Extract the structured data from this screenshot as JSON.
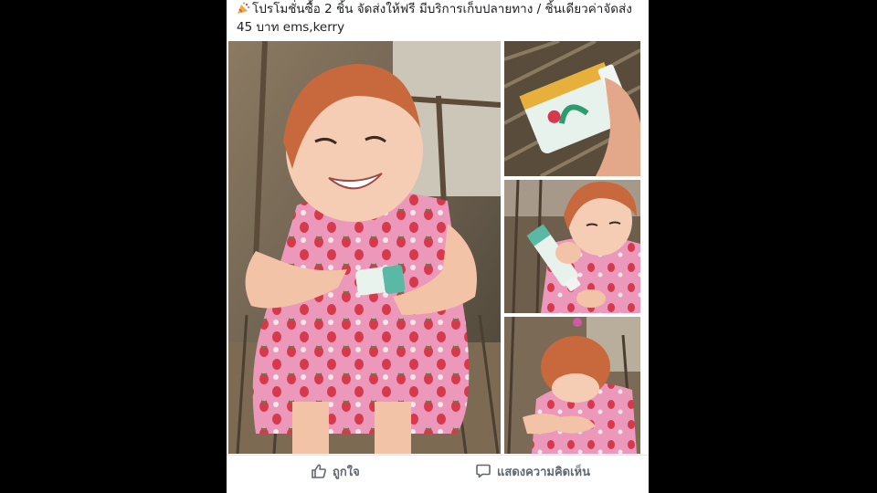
{
  "post": {
    "line1": "โปรโมชั่นซื้อ 2 ชิ้น จัดส่งให้ฟรี มีบริการเก็บปลายทาง / ชิ้นเดียวค่าจัดส่ง",
    "line2": "45 บาท ems,kerry",
    "icon": "party-popper-icon"
  },
  "photos": [
    {
      "name": "child-applying-cream-main"
    },
    {
      "name": "product-tube-in-hand"
    },
    {
      "name": "child-holding-tube"
    },
    {
      "name": "child-rubbing-cream"
    }
  ],
  "actions": {
    "like_label": "ถูกใจ",
    "comment_label": "แสดงความคิดเห็น"
  },
  "colors": {
    "background": "#000000",
    "card": "#ffffff",
    "action_text": "#606770",
    "dress_pink": "#e98bb2",
    "strawberry_red": "#d6394b"
  }
}
